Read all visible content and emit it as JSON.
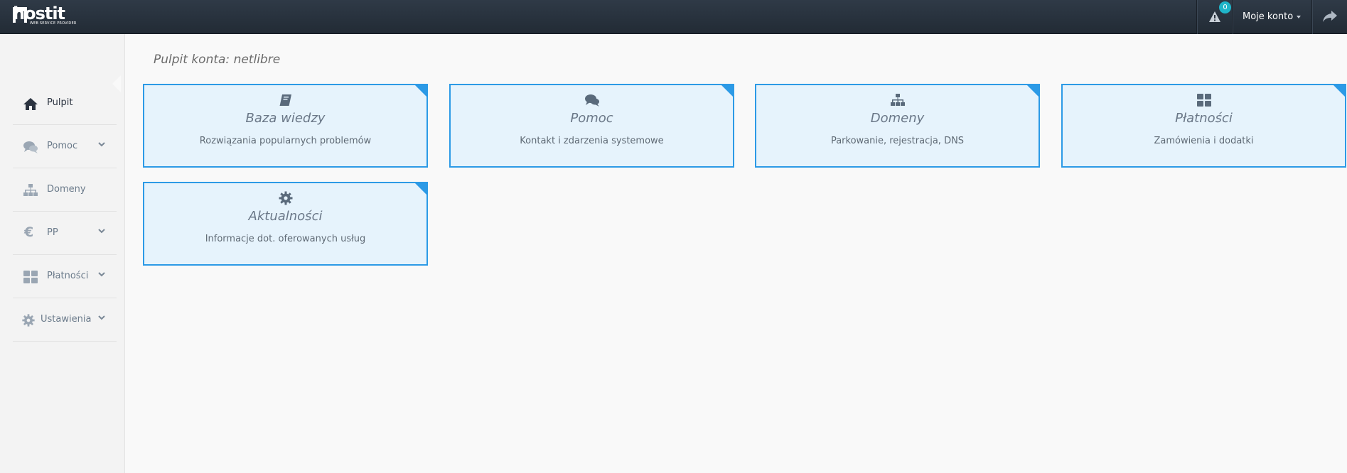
{
  "header": {
    "logo_text": "hostit",
    "logo_tagline": "WEB SERVICE PROVIDER",
    "alerts_count": "0",
    "account_label": "Moje konto"
  },
  "sidebar": {
    "items": [
      {
        "label": "Pulpit",
        "icon": "home-icon",
        "active": true
      },
      {
        "label": "Pomoc",
        "icon": "comments-icon",
        "expandable": true
      },
      {
        "label": "Domeny",
        "icon": "sitemap-icon"
      },
      {
        "label": "PP",
        "icon": "euro-icon",
        "expandable": true
      },
      {
        "label": "Płatności",
        "icon": "grid-icon",
        "expandable": true
      },
      {
        "label": "Ustawienia",
        "icon": "gear-icon",
        "expandable": true
      }
    ]
  },
  "main": {
    "title": "Pulpit konta: netlibre",
    "tiles": [
      {
        "title": "Baza wiedzy",
        "subtitle": "Rozwiązania popularnych problemów",
        "icon": "book-icon"
      },
      {
        "title": "Pomoc",
        "subtitle": "Kontakt i zdarzenia systemowe",
        "icon": "comments-icon"
      },
      {
        "title": "Domeny",
        "subtitle": "Parkowanie, rejestracja, DNS",
        "icon": "sitemap-icon"
      },
      {
        "title": "Płatności",
        "subtitle": "Zamówienia i dodatki",
        "icon": "grid-icon"
      },
      {
        "title": "Aktualności",
        "subtitle": "Informacje dot. oferowanych usług",
        "icon": "gear-icon"
      }
    ]
  },
  "colors": {
    "topbar": "#27313c",
    "tile_border": "#2c9ae6",
    "tile_bg": "#e6f3fc",
    "badge": "#1fb5c9"
  }
}
